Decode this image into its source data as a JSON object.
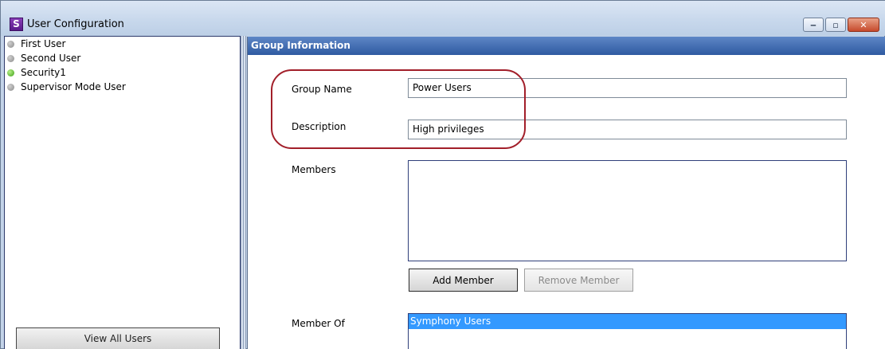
{
  "window": {
    "title": "User Configuration",
    "app_icon_letter": "S",
    "controls": {
      "minimize": "‒",
      "maximize": "▫",
      "close": "✕"
    }
  },
  "users": [
    {
      "name": "First User",
      "status": "offline"
    },
    {
      "name": "Second User",
      "status": "offline"
    },
    {
      "name": "Security1",
      "status": "online"
    },
    {
      "name": "Supervisor Mode User",
      "status": "offline"
    }
  ],
  "left_panel": {
    "view_all_label": "View All Users"
  },
  "group": {
    "header": "Group Information",
    "name_label": "Group Name",
    "name_value": "Power Users",
    "description_label": "Description",
    "description_value": "High privileges",
    "members_label": "Members",
    "members": [],
    "add_member_label": "Add Member",
    "remove_member_label": "Remove Member",
    "member_of_label": "Member Of",
    "member_of": [
      "Symphony Users"
    ]
  },
  "colors": {
    "header_blue": "#2f5aa1",
    "selection": "#3399ff",
    "highlight": "#a21f2a",
    "online": "#3c9f14",
    "offline": "#8a8a8a"
  }
}
